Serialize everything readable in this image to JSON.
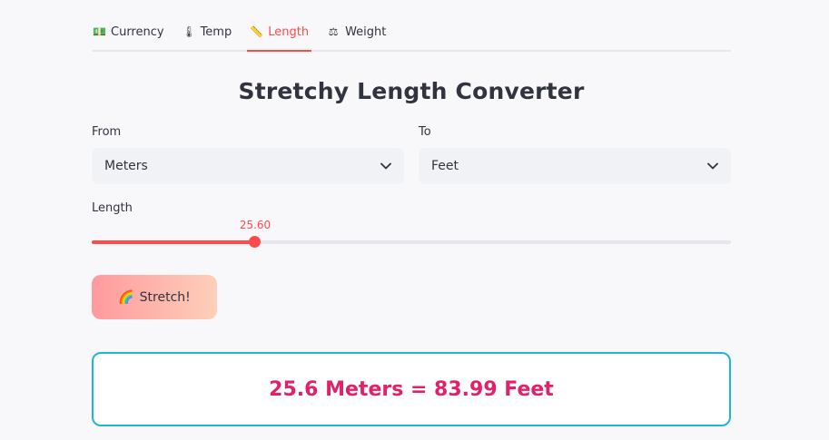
{
  "tabs": [
    {
      "label": "Currency",
      "icon": "💵",
      "icon_name": "money-icon",
      "active": false
    },
    {
      "label": "Temp",
      "icon": "🌡",
      "icon_name": "thermometer-icon",
      "active": false
    },
    {
      "label": "Length",
      "icon": "📏",
      "icon_name": "ruler-icon",
      "active": true
    },
    {
      "label": "Weight",
      "icon": "⚖",
      "icon_name": "scale-icon",
      "active": false
    }
  ],
  "title": "Stretchy Length Converter",
  "from": {
    "label": "From",
    "value": "Meters"
  },
  "to": {
    "label": "To",
    "value": "Feet"
  },
  "slider": {
    "label": "Length",
    "value_text": "25.60",
    "fraction": 0.255
  },
  "button": {
    "label": "Stretch!",
    "icon": "🌈",
    "icon_name": "rainbow-icon"
  },
  "result": {
    "text": "25.6 Meters = 83.99 Feet"
  },
  "colors": {
    "accent": "#ff4b4b",
    "result_text": "#e3216a",
    "result_border": "#1fb8d1",
    "button_gradient_start": "#ff9a9e",
    "button_gradient_end": "#fecfb9"
  }
}
